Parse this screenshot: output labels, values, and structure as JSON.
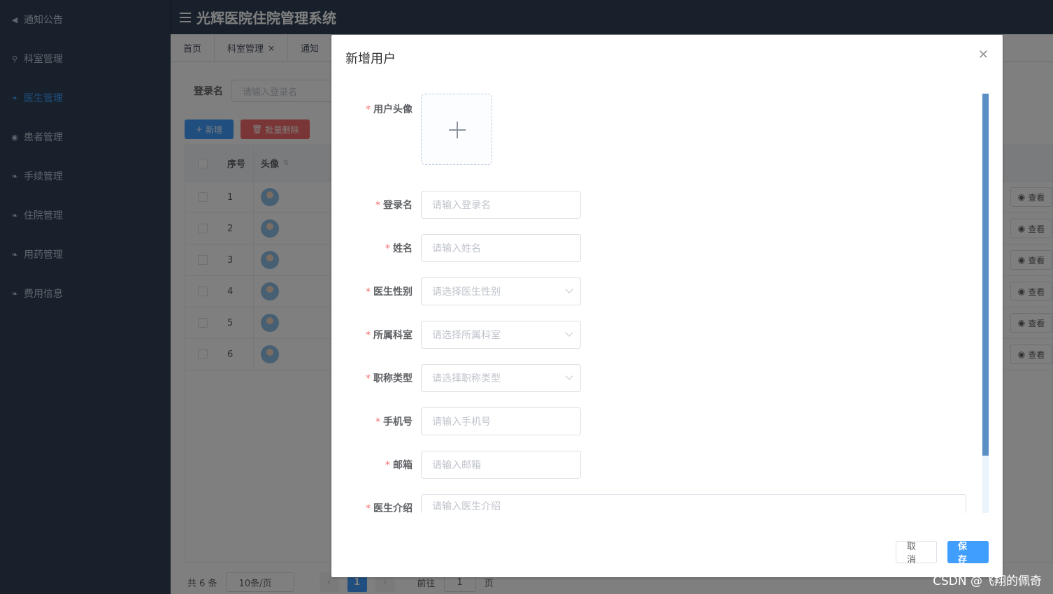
{
  "app": {
    "title": "光辉医院住院管理系统"
  },
  "sidebar": {
    "items": [
      {
        "label": "通知公告",
        "icon": "megaphone-icon",
        "active": false
      },
      {
        "label": "科室管理",
        "icon": "sitemap-icon",
        "active": false
      },
      {
        "label": "医生管理",
        "icon": "leaf-icon",
        "active": true
      },
      {
        "label": "患者管理",
        "icon": "user-circle-icon",
        "active": false
      },
      {
        "label": "手续管理",
        "icon": "leaf-icon",
        "active": false
      },
      {
        "label": "住院管理",
        "icon": "leaf-icon",
        "active": false
      },
      {
        "label": "用药管理",
        "icon": "leaf-icon",
        "active": false
      },
      {
        "label": "费用信息",
        "icon": "leaf-icon",
        "active": false
      }
    ]
  },
  "tabs": [
    {
      "label": "首页"
    },
    {
      "label": "科室管理",
      "closable": true
    },
    {
      "label": "通知"
    }
  ],
  "search": {
    "label": "登录名",
    "placeholder": "请输入登录名"
  },
  "actions": {
    "add": "新增",
    "batch_delete": "批量删除"
  },
  "table": {
    "headers": {
      "index": "序号",
      "avatar": "头像"
    },
    "rows": [
      {
        "no": "1"
      },
      {
        "no": "2"
      },
      {
        "no": "3"
      },
      {
        "no": "4"
      },
      {
        "no": "5"
      },
      {
        "no": "6"
      }
    ],
    "view_label": "查看"
  },
  "pager": {
    "total": "共 6 条",
    "page_size": "10条/页",
    "current": "1",
    "goto_prefix": "前往",
    "goto_value": "1",
    "goto_suffix": "页"
  },
  "dialog": {
    "title": "新增用户",
    "fields": {
      "avatar": "用户头像",
      "login": {
        "label": "登录名",
        "placeholder": "请输入登录名"
      },
      "name": {
        "label": "姓名",
        "placeholder": "请输入姓名"
      },
      "gender": {
        "label": "医生性别",
        "placeholder": "请选择医生性别"
      },
      "dept": {
        "label": "所属科室",
        "placeholder": "请选择所属科室"
      },
      "title": {
        "label": "职称类型",
        "placeholder": "请选择职称类型"
      },
      "phone": {
        "label": "手机号",
        "placeholder": "请输入手机号"
      },
      "email": {
        "label": "邮箱",
        "placeholder": "请输入邮箱"
      },
      "intro": {
        "label": "医生介绍",
        "placeholder": "请输入医生介绍"
      }
    },
    "required_mark": "*",
    "cancel": "取 消",
    "save": "保 存"
  },
  "watermark": "CSDN @飞翔的佩奇",
  "colors": {
    "primary": "#409eff",
    "danger": "#f56c6c",
    "sidebar": "#304156"
  }
}
